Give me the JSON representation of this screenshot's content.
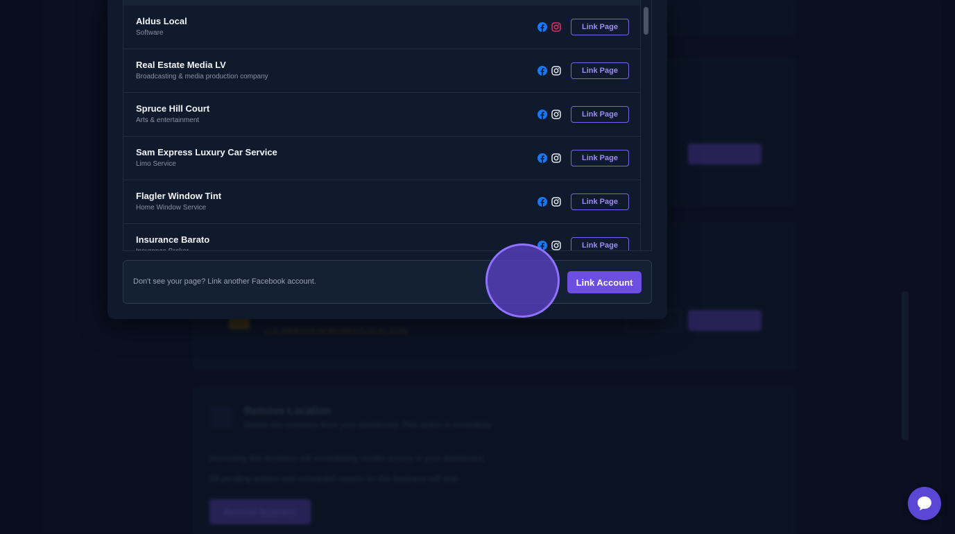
{
  "background": {
    "remove_title": "Remove Location",
    "remove_subtitle": "Delete this business from your dashboard. This action is immediate.",
    "remove_line1": "Removing this business will immediately revoke access in your dashboard.",
    "remove_line2": "All pending actions and scheduled reports for this business will stop.",
    "remove_button": "Remove Business",
    "domain_text": "LLC-WEBSITE.NORDWESTLOCAL.COM"
  },
  "modal": {
    "pages": [
      {
        "name": "Aldus Local",
        "category": "Software",
        "instagram_color": "#e1306c",
        "link_label": "Link Page"
      },
      {
        "name": "Real Estate Media LV",
        "category": "Broadcasting & media production company",
        "instagram_color": "#e6e9f0",
        "link_label": "Link Page"
      },
      {
        "name": "Spruce Hill Court",
        "category": "Arts & entertainment",
        "instagram_color": "#e6e9f0",
        "link_label": "Link Page"
      },
      {
        "name": "Sam Express Luxury Car Service",
        "category": "Limo Service",
        "instagram_color": "#e6e9f0",
        "link_label": "Link Page"
      },
      {
        "name": "Flagler Window Tint",
        "category": "Home Window Service",
        "instagram_color": "#e6e9f0",
        "link_label": "Link Page"
      },
      {
        "name": "Insurance Barato",
        "category": "Insurance Broker",
        "instagram_color": "#e6e9f0",
        "link_label": "Link Page"
      }
    ],
    "footer_text": "Don't see your page? Link another Facebook account.",
    "link_account_label": "Link Account"
  },
  "colors": {
    "accent": "#6c4fe0",
    "facebook": "#1877f2",
    "instagram_active": "#e1306c"
  },
  "icons": {
    "facebook": "facebook-icon",
    "instagram": "instagram-icon",
    "chat": "chat-icon"
  }
}
